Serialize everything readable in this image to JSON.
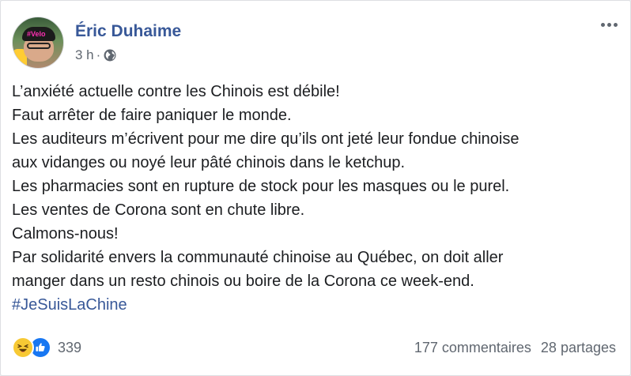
{
  "post": {
    "author": "Éric Duhaime",
    "time": "3 h",
    "dot": "·",
    "avatar_cap_text": "#Velo",
    "body_lines": [
      "L’anxiété actuelle contre les Chinois est débile!",
      "Faut arrêter de faire paniquer le monde.",
      "Les auditeurs m’écrivent pour me dire qu’ils ont jeté leur fondue chinoise",
      "aux vidanges ou noyé leur pâté chinois dans le ketchup.",
      "Les pharmacies sont en rupture de stock pour les masques ou le purel.",
      "Les ventes de Corona sont en chute libre.",
      "Calmons-nous!",
      "Par solidarité envers la communauté chinoise au Québec, on doit aller",
      "manger dans un resto chinois ou boire de la Corona ce week-end."
    ],
    "hashtag": "#JeSuisLaChine"
  },
  "footer": {
    "reaction_count": "339",
    "comments": "177 commentaires",
    "shares": "28 partages"
  },
  "colors": {
    "author_link": "#385898",
    "text": "#1c1e21",
    "muted": "#606770",
    "like_blue": "#1877f2",
    "haha_yellow": "#f7c934"
  },
  "icons": {
    "privacy": "globe-icon",
    "menu": "more-options-icon",
    "reaction_1": "haha-reaction-icon",
    "reaction_2": "like-reaction-icon"
  }
}
